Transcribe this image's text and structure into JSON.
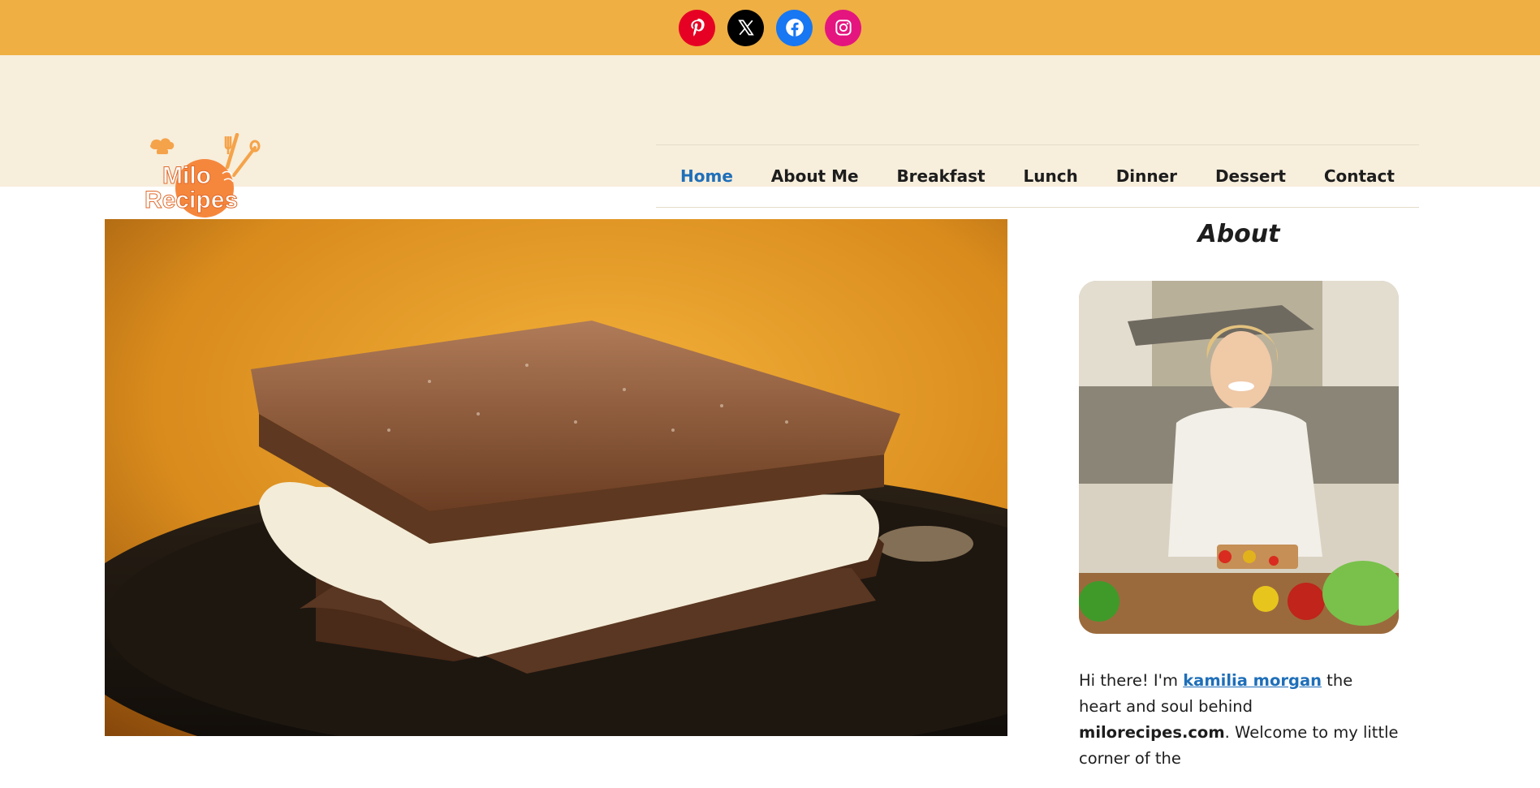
{
  "social": {
    "pinterest": {
      "icon": "pinterest-icon",
      "color": "#e60023"
    },
    "x": {
      "icon": "x-icon",
      "color": "#000000"
    },
    "facebook": {
      "icon": "facebook-icon",
      "color": "#1877f2"
    },
    "instagram": {
      "icon": "instagram-icon",
      "color": "#e4157f"
    }
  },
  "logo": {
    "line1": "Milo",
    "line2": "Recipes"
  },
  "nav": {
    "items": [
      {
        "label": "Home",
        "active": true
      },
      {
        "label": "About Me"
      },
      {
        "label": "Breakfast"
      },
      {
        "label": "Lunch"
      },
      {
        "label": "Dinner"
      },
      {
        "label": "Dessert"
      },
      {
        "label": "Contact"
      }
    ]
  },
  "sidebar": {
    "title": "About",
    "intro_before": "Hi there! I'm ",
    "author_link": "kamilia morgan",
    "intro_middle": " the heart and soul behind ",
    "site_name": "milorecipes.com",
    "intro_after": ". Welcome to my little corner of the"
  },
  "colors": {
    "topbar": "#efaf43",
    "header": "#f7eedc",
    "nav_active": "#1f6fb9",
    "logo_orange": "#f5873d"
  }
}
